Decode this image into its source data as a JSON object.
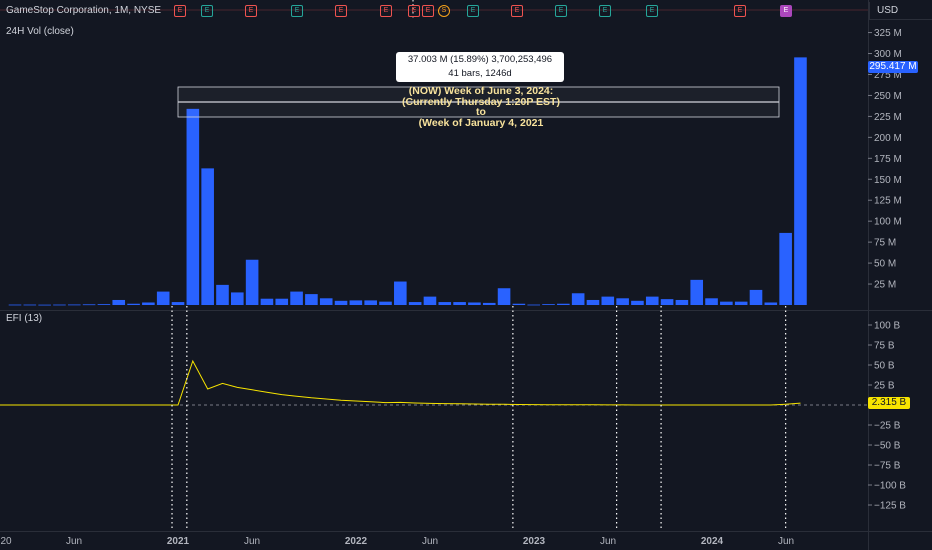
{
  "header": {
    "title": "GameStop Corporation, 1M, NYSE",
    "currency": "USD"
  },
  "volume_pane": {
    "label": "24H Vol (close)",
    "axis_ticks": [
      "325 M",
      "300 M",
      "275 M",
      "250 M",
      "225 M",
      "200 M",
      "175 M",
      "150 M",
      "125 M",
      "100 M",
      "75 M",
      "50 M",
      "25 M"
    ],
    "last_value_tag": "295.417 M"
  },
  "efi_pane": {
    "label": "EFI (13)",
    "axis_ticks": [
      "100 B",
      "75 B",
      "50 B",
      "25 B",
      "−25 B",
      "−50 B",
      "−75 B",
      "−100 B",
      "−125 B"
    ],
    "last_value_tag": "2.315 B"
  },
  "time_axis": [
    "20",
    "Jun",
    "2021",
    "Jun",
    "2022",
    "Jun",
    "2023",
    "Jun",
    "2024",
    "Jun"
  ],
  "measure_tooltip": {
    "line1": "37.003 M (15.89%) 3,700,253,496",
    "line2": "41 bars, 1246d"
  },
  "annotation": {
    "line1": "(NOW) Week of June 3, 2024:",
    "line2": "(Currently Thursday 1:20P EST)",
    "line3": "to",
    "line4": "(Week of January 4, 2021"
  },
  "event_icons": [
    {
      "type": "E",
      "color": "#ef5350"
    },
    {
      "type": "E",
      "color": "#26a69a"
    },
    {
      "type": "E",
      "color": "#ef5350"
    },
    {
      "type": "E",
      "color": "#26a69a"
    },
    {
      "type": "E",
      "color": "#ef5350"
    },
    {
      "type": "E",
      "color": "#ef5350"
    },
    {
      "type": "E",
      "color": "#ef5350"
    },
    {
      "type": "E",
      "color": "#ef5350"
    },
    {
      "type": "S",
      "color": "#f7a21b"
    },
    {
      "type": "E",
      "color": "#26a69a"
    },
    {
      "type": "E",
      "color": "#ef5350"
    },
    {
      "type": "E",
      "color": "#26a69a"
    },
    {
      "type": "E",
      "color": "#26a69a"
    },
    {
      "type": "E",
      "color": "#26a69a"
    },
    {
      "type": "E",
      "color": "#ef5350"
    },
    {
      "type": "E",
      "color": "#ab47bc"
    }
  ],
  "colors": {
    "volume_bar": "#2962ff",
    "efi_line": "#f7e400",
    "background": "#131722"
  },
  "chart_data": [
    {
      "type": "bar",
      "title": "24H Vol (close)",
      "ylabel": "",
      "ylim": [
        0,
        340
      ],
      "unit": "M",
      "values": [
        0.5,
        0.5,
        0.4,
        0.5,
        0.6,
        0.8,
        1,
        6,
        1.5,
        3,
        16,
        3.5,
        234,
        163,
        24,
        15,
        54,
        7.5,
        7.5,
        16,
        13,
        8,
        5,
        5.5,
        5.5,
        4,
        28,
        3.5,
        10,
        3.5,
        3.5,
        3,
        2.5,
        20,
        1.5,
        0.5,
        1,
        1.5,
        14,
        6,
        10,
        8,
        5,
        10,
        7,
        6,
        30,
        8,
        4,
        4,
        18,
        3,
        86,
        295.417
      ]
    },
    {
      "type": "line",
      "title": "EFI (13)",
      "ylabel": "",
      "ylim": [
        -135,
        110
      ],
      "unit": "B",
      "values": [
        0,
        0,
        0,
        0,
        0,
        0,
        0,
        0,
        0,
        0,
        0,
        0,
        55,
        20,
        27,
        22,
        19,
        16,
        13,
        11,
        9,
        7.5,
        6,
        5,
        4,
        3,
        3.2,
        2.5,
        2,
        1.8,
        1.5,
        1.3,
        1,
        0.9,
        0.6,
        0.5,
        0.4,
        0.3,
        0.2,
        0.2,
        0.1,
        0.1,
        0,
        0,
        0,
        0,
        0,
        0,
        0,
        0,
        0,
        0,
        1,
        2.315
      ]
    }
  ]
}
